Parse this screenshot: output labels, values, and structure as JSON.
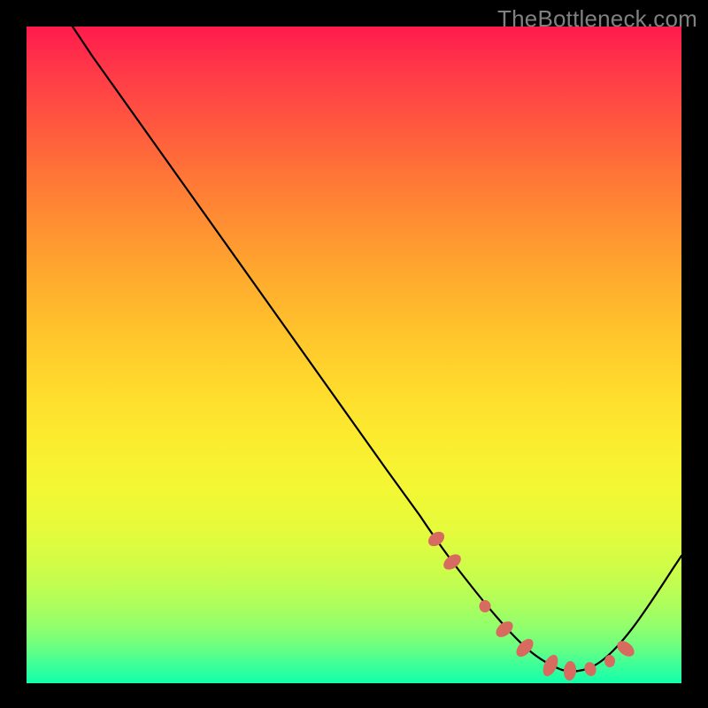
{
  "watermark": "TheBottleneck.com",
  "colors": {
    "background": "#000000",
    "gradient_top": "#ff1a4d",
    "gradient_bottom": "#12ffab",
    "curve": "#000000",
    "marker": "#d86b60"
  },
  "chart_data": {
    "type": "line",
    "title": "",
    "xlabel": "",
    "ylabel": "",
    "xlim": [
      0,
      100
    ],
    "ylim": [
      0,
      100
    ],
    "x": [
      7,
      10,
      15,
      20,
      25,
      30,
      35,
      40,
      45,
      50,
      55,
      60,
      62,
      64,
      66,
      68,
      70,
      72,
      74,
      76,
      78,
      80,
      82,
      84,
      86,
      88,
      90,
      92,
      94,
      96,
      98,
      100
    ],
    "y": [
      100,
      95.5,
      88.5,
      81.5,
      74.5,
      67.5,
      60.5,
      53.5,
      46.5,
      39.5,
      32.5,
      25.5,
      22.7,
      19.9,
      17.1,
      14.3,
      11.7,
      9.3,
      7.2,
      5.4,
      3.9,
      2.8,
      2.1,
      1.8,
      2.0,
      2.7,
      3.9,
      5.5,
      7.6,
      10.1,
      13.0,
      16.2
    ],
    "markers": {
      "comment": "highlighted salmon points/segments along the curve near the bottom valley",
      "points_x": [
        62.5,
        65,
        70,
        73,
        76,
        80,
        83,
        86,
        89,
        91.5
      ],
      "points_y": [
        22,
        18.5,
        11.7,
        8.2,
        5.4,
        2.8,
        2.0,
        2.0,
        3.3,
        5.0
      ]
    }
  }
}
